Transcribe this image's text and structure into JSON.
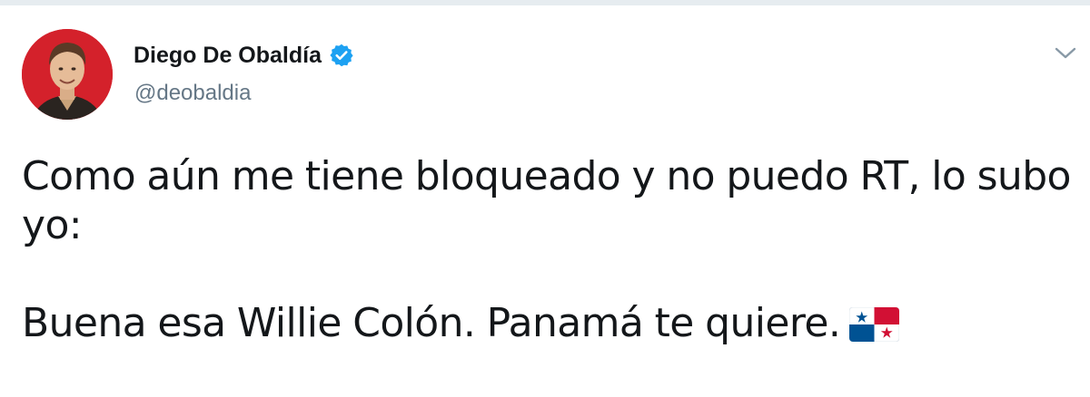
{
  "tweet": {
    "author": {
      "display_name": "Diego De Obaldía",
      "handle": "@deobaldia",
      "verified": true,
      "avatar_icon": "profile-photo"
    },
    "text_lines": [
      "Como aún me tiene bloqueado y no puedo RT, lo subo",
      "yo:",
      "",
      "Buena esa Willie Colón. Panamá te quiere."
    ],
    "emoji": "panama-flag",
    "menu_icon": "chevron-down-icon"
  },
  "colors": {
    "verified_blue": "#1da1f2",
    "handle_gray": "#657786",
    "text": "#14171a",
    "flag_red": "#d21034",
    "flag_blue": "#005293"
  }
}
